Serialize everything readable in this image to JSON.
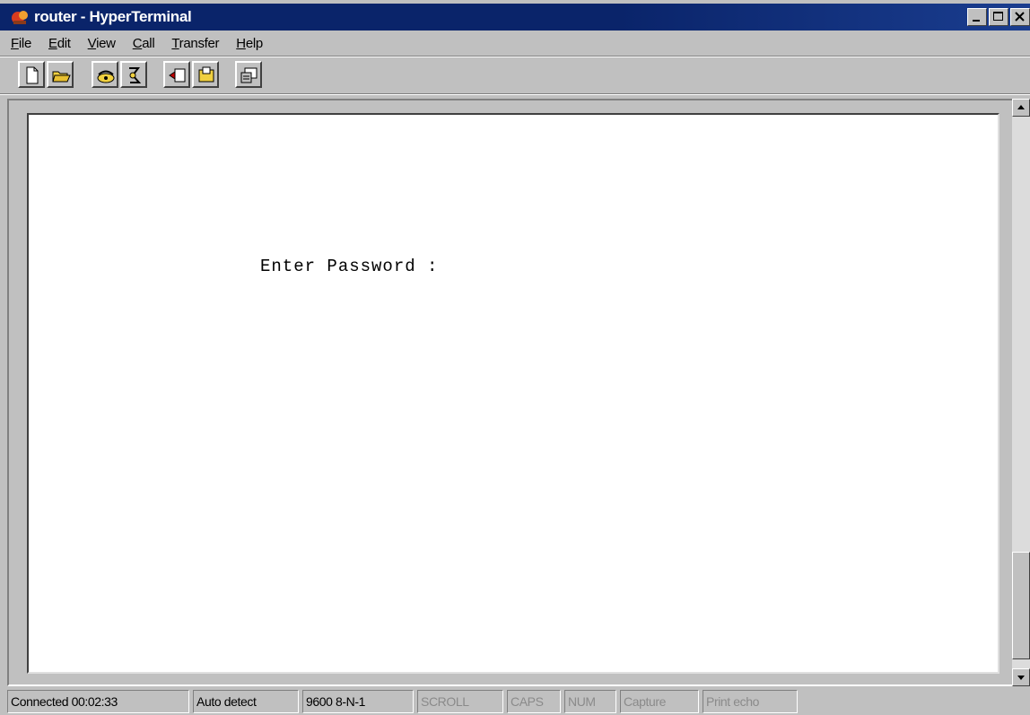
{
  "window": {
    "title": "router - HyperTerminal"
  },
  "menu": {
    "items": [
      {
        "mnemonic": "F",
        "rest": "ile"
      },
      {
        "mnemonic": "E",
        "rest": "dit"
      },
      {
        "mnemonic": "V",
        "rest": "iew"
      },
      {
        "mnemonic": "C",
        "rest": "all"
      },
      {
        "mnemonic": "T",
        "rest": "ransfer"
      },
      {
        "mnemonic": "H",
        "rest": "elp"
      }
    ]
  },
  "toolbar": {
    "buttons": [
      "new-icon",
      "open-icon",
      "connect-icon",
      "disconnect-icon",
      "send-icon",
      "receive-icon",
      "properties-icon"
    ]
  },
  "terminal": {
    "text": "Enter Password :"
  },
  "status": {
    "connection": "Connected 00:02:33",
    "detect": "Auto detect",
    "settings": "9600 8-N-1",
    "scroll": "SCROLL",
    "caps": "CAPS",
    "num": "NUM",
    "capture": "Capture",
    "print_echo": "Print echo"
  }
}
